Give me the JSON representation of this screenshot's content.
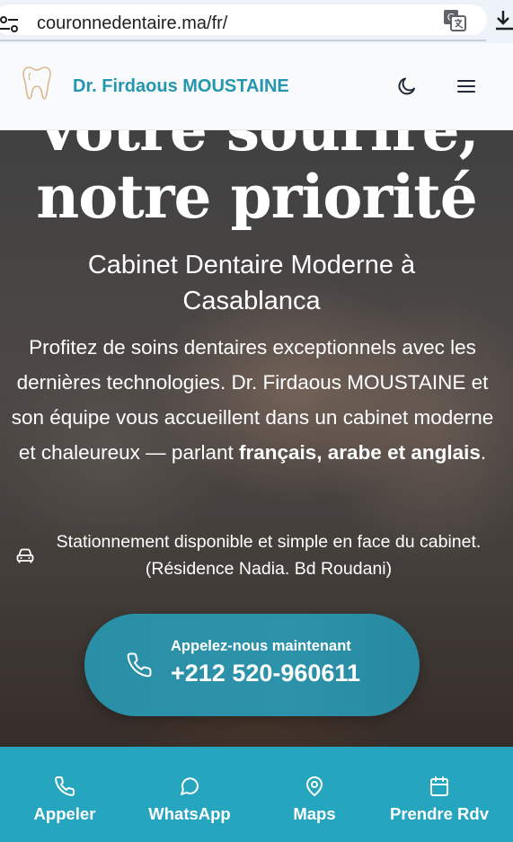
{
  "browser": {
    "url": "couronnedentaire.ma/fr/",
    "icons": [
      "tune-icon",
      "translate-icon",
      "download-icon"
    ]
  },
  "header": {
    "brand": "Dr. Firdaous MOUSTAINE",
    "icons": [
      "tooth-logo-icon",
      "moon-icon",
      "hamburger-menu-icon"
    ],
    "brand_color": "#2596b0"
  },
  "hero": {
    "title_line1": "Votre sourire,",
    "title_line2": "notre priorité",
    "subtitle": "Cabinet Dentaire Moderne à Casablanca",
    "description_start": "Profitez de soins dentaires exceptionnels avec les dernières technologies. Dr. Firdaous MOUSTAINE et son équipe vous accueillent dans un cabinet moderne et chaleureux — parlant ",
    "description_bold": "français, arabe et anglais",
    "description_end": ".",
    "parking": "Stationnement disponible et simple en face du cabinet. (Résidence Nadia. Bd Roudani)",
    "parking_icon": "car-icon"
  },
  "call": {
    "label": "Appelez-nous maintenant",
    "number": "+212 520-960611",
    "icon": "phone-icon",
    "color": "#2a8fa6"
  },
  "bottom_nav": {
    "color": "#26a5bf",
    "items": [
      {
        "label": "Appeler",
        "icon": "phone-icon"
      },
      {
        "label": "WhatsApp",
        "icon": "chat-bubble-icon"
      },
      {
        "label": "Maps",
        "icon": "map-pin-icon"
      },
      {
        "label": "Prendre Rdv",
        "icon": "calendar-icon"
      }
    ]
  }
}
